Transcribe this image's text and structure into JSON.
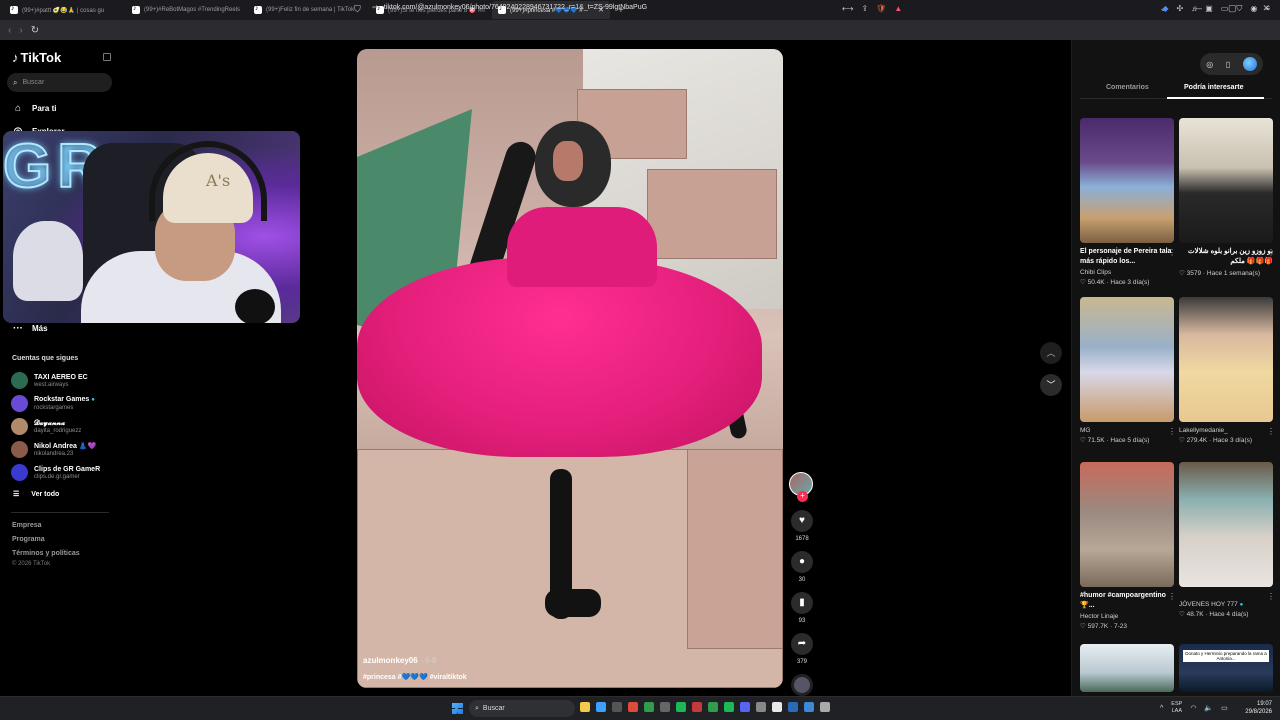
{
  "browser": {
    "tabs": [
      {
        "label": "(99+)#pattt 🥑😂🙏 | cosas gu",
        "active": false
      },
      {
        "label": "(99+)#ReBotMagos #TrendingReels",
        "active": false
      },
      {
        "label": "(99+)Feliz fin de semana | TikTok",
        "active": false
      },
      {
        "label": "(99+)Si te nés pierdes parte 8 🎯 #n",
        "active": false
      },
      {
        "label": "(99+)#princesa #💙💙💙 #",
        "active": true
      }
    ],
    "url": "tiktok.com/@azulmonkey06/photo/7649240228946731722_r=1&_t=ZS-99lgtNbaPuG"
  },
  "sidebar": {
    "logo": "TikTok",
    "search_placeholder": "Buscar",
    "nav": [
      {
        "label": "Para ti",
        "icon": "home-icon"
      },
      {
        "label": "Explorar",
        "icon": "compass-icon"
      },
      {
        "label": "Más",
        "icon": "more-icon"
      }
    ],
    "following_title": "Cuentas que sigues",
    "accounts": [
      {
        "name": "TAXI AEREO EC",
        "handle": "west.airways",
        "color": "#2c6b52",
        "verified": false
      },
      {
        "name": "Rockstar Games",
        "handle": "rockstargames",
        "color": "#6a4bd8",
        "verified": true
      },
      {
        "name": "𝓓𝓪𝔂𝓪𝓷𝓷𝓪",
        "handle": "dayita_rodriguezz",
        "color": "#b08a6a",
        "verified": false
      },
      {
        "name": "Nikol Andrea 👗💜",
        "handle": "nikolandrea.23",
        "color": "#8a5a4a",
        "verified": false
      },
      {
        "name": "Clips de GR GameR",
        "handle": "clips.de.gr.gamer",
        "color": "#3a3ad0",
        "verified": false
      }
    ],
    "see_all": "Ver todo",
    "footer_links": [
      "Empresa",
      "Programa",
      "Términos y políticas"
    ],
    "copyright": "© 2026 TikTok"
  },
  "post": {
    "username": "azulmonkey06",
    "date": "· 6-8",
    "caption_parts": [
      "#princesa #",
      "💙💙💙",
      " #viraltiktok"
    ],
    "likes": "1678",
    "comments": "30",
    "saves": "93",
    "shares": "379"
  },
  "right_panel": {
    "tabs": [
      "Comentarios",
      "Podría interesarte"
    ],
    "cards": [
      {
        "title": "El personaje de Pereira tala más rápido los...",
        "author": "Chibi Clips",
        "likes": "50.4K",
        "age": "Hace 3 día(s)"
      },
      {
        "title": "بو زوزو زين برانو بلوه شلالات 🎁🎁🎁 ملكم",
        "author": "زمان و خذران ❤️",
        "likes": "3579",
        "age": "Hace 1 semana(s)"
      },
      {
        "title": "",
        "author": "MG",
        "likes": "71.5K",
        "age": "Hace 5 día(s)"
      },
      {
        "title": "",
        "author": "Lakellymedanie_",
        "likes": "279.4K",
        "age": "Hace 3 día(s)"
      },
      {
        "title": "#humor #campoargentino 🏆...",
        "author": "Hector Linaje",
        "likes": "597.7K",
        "age": "7-23"
      },
      {
        "title": "",
        "author": "JÓVENES HOY 777",
        "likes": "48.7K",
        "age": "Hace 4 día(s)"
      }
    ],
    "thumb_caption": "Donato y Herminio preparando la rama a Antonia..."
  },
  "taskbar": {
    "search": "Buscar",
    "lang_top": "ESP",
    "lang_bottom": "LAA",
    "time": "19:07",
    "date": "29/8/2026"
  },
  "colors": {
    "accent": "#fe2c55",
    "verified": "#20d5ec",
    "dress": "#e51f7c"
  }
}
